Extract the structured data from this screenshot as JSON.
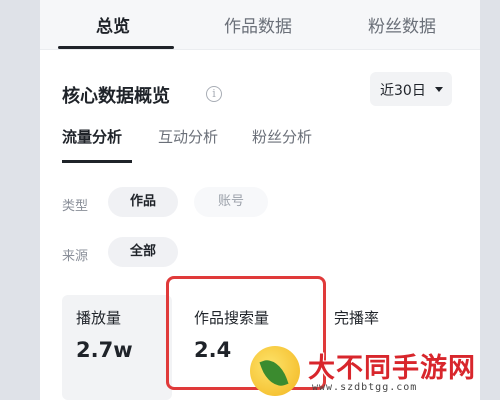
{
  "top_tabs": [
    {
      "label": "总览",
      "active": true
    },
    {
      "label": "作品数据",
      "active": false
    },
    {
      "label": "粉丝数据",
      "active": false
    }
  ],
  "section": {
    "title": "核心数据概览",
    "info_icon": "info-icon",
    "date_range": "近30日"
  },
  "sub_tabs": [
    {
      "label": "流量分析",
      "active": true
    },
    {
      "label": "互动分析",
      "active": false
    },
    {
      "label": "粉丝分析",
      "active": false
    }
  ],
  "filters": {
    "type": {
      "label": "类型",
      "options": [
        {
          "label": "作品",
          "selected": true
        },
        {
          "label": "账号",
          "selected": false
        }
      ]
    },
    "source": {
      "label": "来源",
      "options": [
        {
          "label": "全部",
          "selected": true
        }
      ]
    }
  },
  "metrics": [
    {
      "label": "播放量",
      "value": "2.7w"
    },
    {
      "label": "作品搜索量",
      "value": "2.4"
    },
    {
      "label": "完播率",
      "value": ""
    }
  ],
  "watermark": {
    "title": "大不同手游网",
    "url": "www.szdbtgg.com"
  },
  "colors": {
    "highlight": "#e03a3a",
    "watermark_text": "#d8262c"
  }
}
